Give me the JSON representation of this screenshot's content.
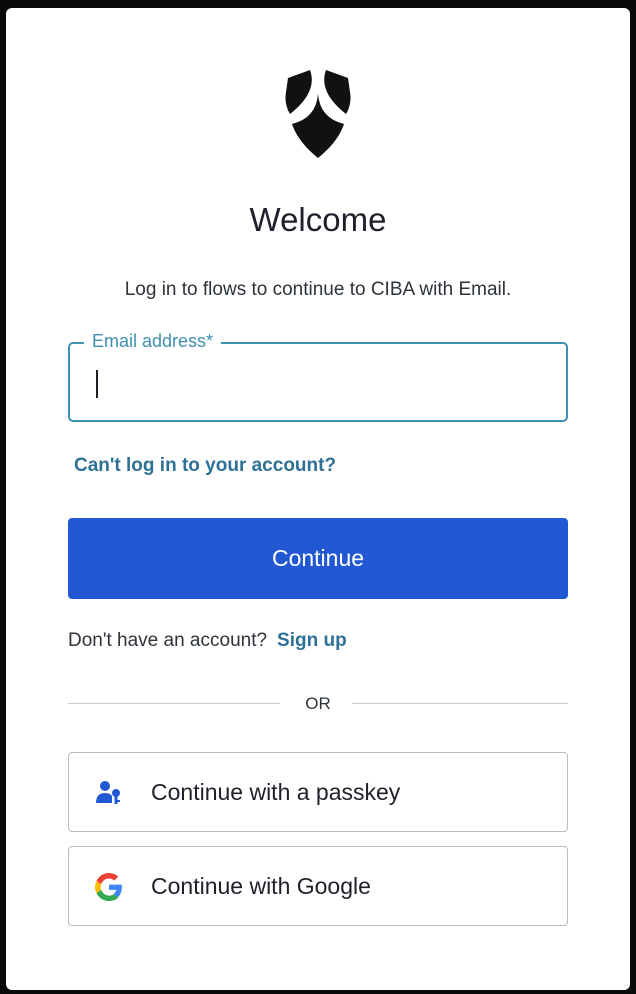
{
  "header": {
    "logo_icon": "shield-star-icon",
    "title": "Welcome",
    "subtitle": "Log in to flows to continue to CIBA with Email."
  },
  "form": {
    "email_label": "Email address*",
    "email_value": "",
    "forgot_link": "Can't log in to your account?",
    "continue_label": "Continue"
  },
  "signup": {
    "prompt": "Don't have an account?",
    "link": "Sign up"
  },
  "divider": {
    "label": "OR"
  },
  "social": {
    "passkey": {
      "label": "Continue with a passkey",
      "icon": "passkey-user-icon"
    },
    "google": {
      "label": "Continue with Google",
      "icon": "google-icon"
    }
  },
  "colors": {
    "primary": "#2358d4",
    "link": "#2e7196",
    "focus_border": "#3e8fb0",
    "text": "#1e212a"
  }
}
